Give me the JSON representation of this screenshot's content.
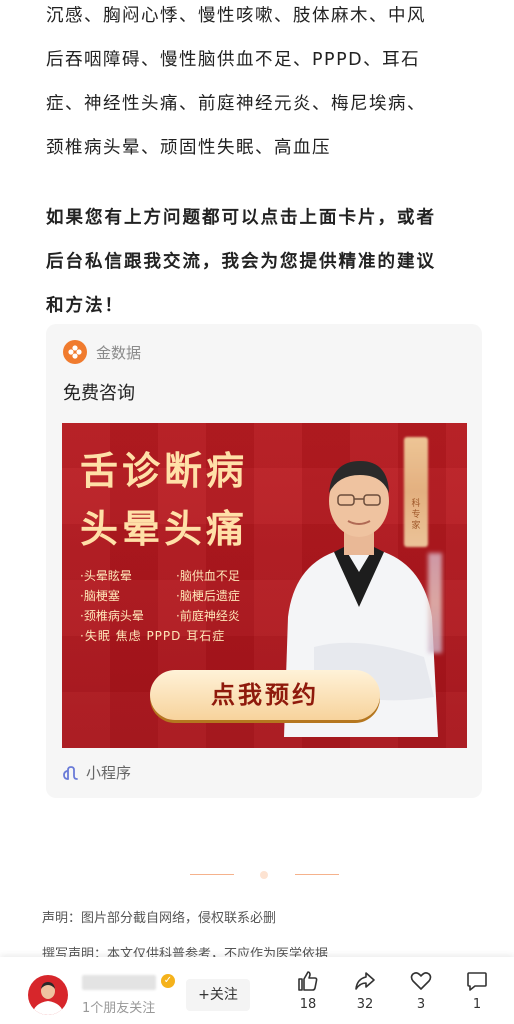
{
  "article": {
    "paragraph1_lines": [
      "沉感、胸闷心悸、慢性咳嗽、肢体麻木、中风",
      "后吞咽障碍、慢性脑供血不足、PPPD、耳石",
      "症、神经性头痛、前庭神经元炎、梅尼埃病、",
      "颈椎病头晕、顽固性失眠、高血压"
    ],
    "paragraph2_lines": [
      "如果您有上方问题都可以点击上面卡片，或者",
      "后台私信跟我交流，我会为您提供精准的建议",
      "和方法！"
    ]
  },
  "card": {
    "source_name": "金数据",
    "title": "免费咨询",
    "footer_label": "小程序",
    "accent_color": "#f07b2e"
  },
  "banner": {
    "title_line1": "舌诊断病",
    "title_line2": "头晕头痛",
    "symptoms": [
      "·头晕眩晕",
      "·脑供血不足",
      "·脑梗塞",
      "·脑梗后遗症",
      "·颈椎病头晕",
      "·前庭神经炎"
    ],
    "symptoms_last": "·失眠 焦虑 PPPD 耳石症",
    "tag_text": "科专家",
    "cta_label": "点我预约",
    "background_color": "#c31f24"
  },
  "disclaimer": {
    "line1": "声明：图片部分截自网络，侵权联系必删",
    "line2": "撰写声明：本文仅供科普参考，不应作为医学依据"
  },
  "bottom_bar": {
    "follow_count": "1个朋友关注",
    "follow_label": "+关注",
    "likes": "18",
    "shares": "32",
    "favorites": "3",
    "comments": "1"
  }
}
